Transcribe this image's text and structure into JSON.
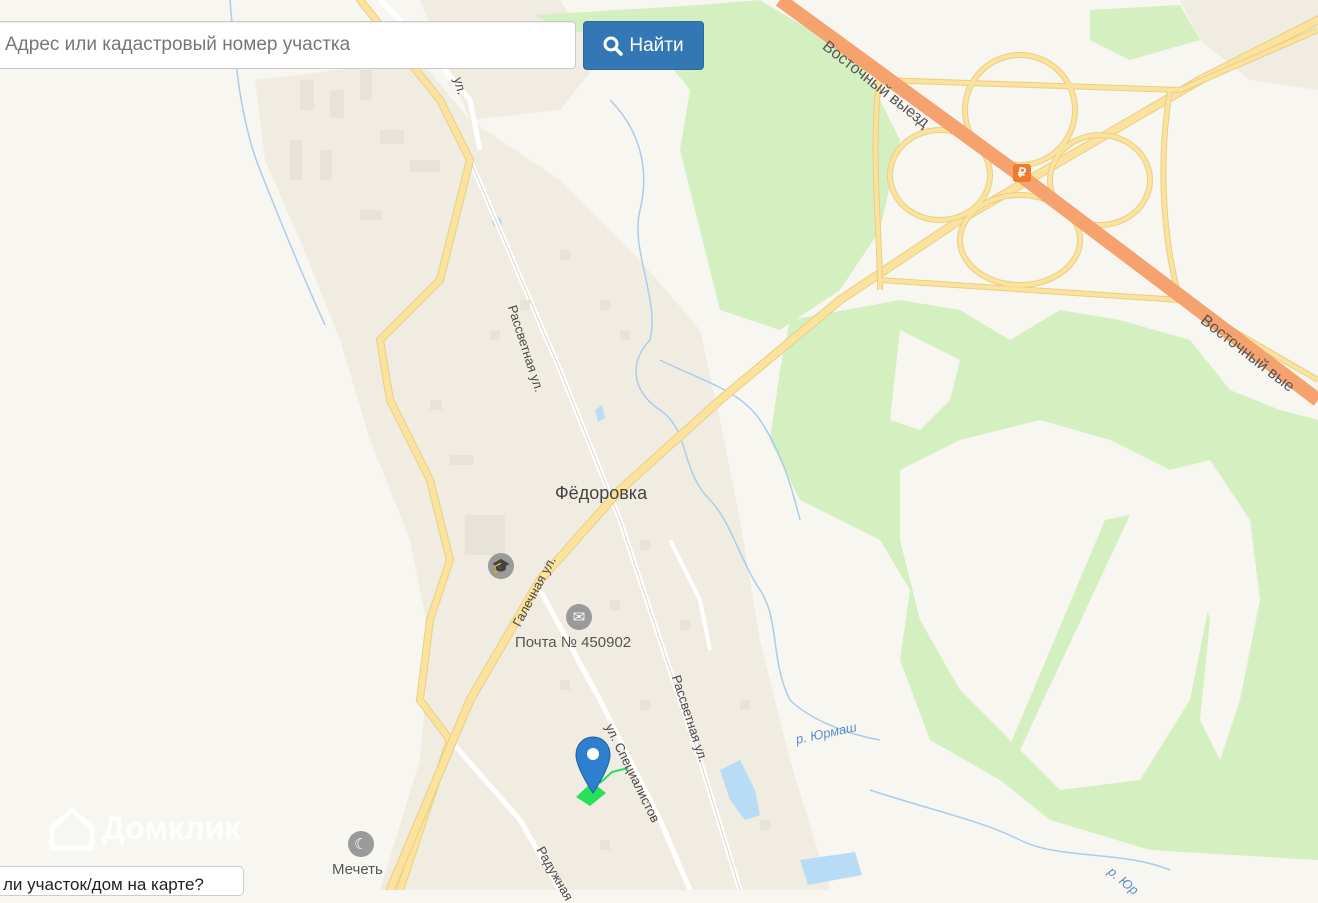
{
  "search": {
    "placeholder": "Адрес или кадастровый номер участка",
    "button_label": "Найти"
  },
  "map": {
    "village": "Фёдоровка",
    "streets": {
      "rassvetnaya_1": "Рассветная ул.",
      "rassvetnaya_2": "Рассветная ул.",
      "galechnaya": "Галечная ул.",
      "specialistov": "ул. Специалистов",
      "raduzhnaya": "Радужная",
      "top_street": "ул."
    },
    "highways": {
      "vostochny_1": "Восточный выезд",
      "vostochny_2": "Восточный вые"
    },
    "rivers": {
      "yurmash_1": "р. Юрмаш",
      "yurmash_2": "р. Юр"
    },
    "pois": {
      "post_office": "Почта № 450902",
      "mosque": "Мечеть"
    },
    "toll_symbol": "₽",
    "watermark": "Домклик"
  },
  "bottom_prompt": "ли участок/дом на карте?",
  "colors": {
    "accent": "#3378b5",
    "highway": "#f5a26e",
    "road": "#fbe39d",
    "forest": "#d4f0c0",
    "water": "#b8dcf5",
    "marker": "#2f7fd0",
    "parcel": "#28e05a"
  },
  "icons": {
    "search_button": "magnifier-icon",
    "location_marker": "map-pin-icon",
    "school": "graduation-cap-icon",
    "post": "envelope-icon",
    "mosque": "crescent-icon",
    "toll": "ruble-icon"
  }
}
